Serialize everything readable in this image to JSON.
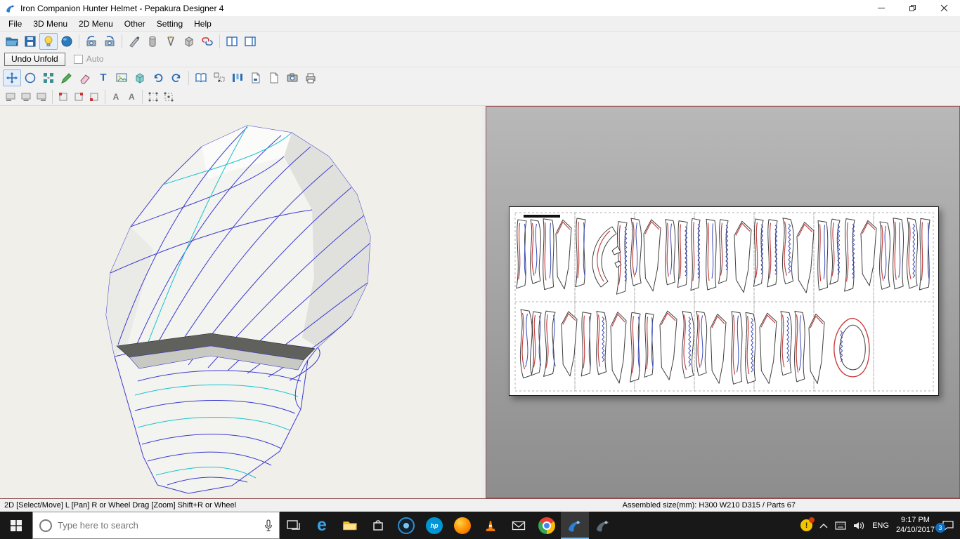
{
  "window": {
    "title": "Iron Companion Hunter Helmet - Pepakura Designer 4"
  },
  "menu": {
    "items": [
      {
        "label": "File"
      },
      {
        "label": "3D Menu"
      },
      {
        "label": "2D Menu"
      },
      {
        "label": "Other"
      },
      {
        "label": "Setting"
      },
      {
        "label": "Help"
      }
    ]
  },
  "toolbar_main": {
    "icon_names": [
      "open-file",
      "save",
      "toggle-light",
      "textured-view",
      "rotate-view-left",
      "rotate-view-right",
      "marker-pen",
      "cylinder-tool",
      "measure-tool",
      "solid-view",
      "link-2d-3d",
      "two-pane-layout",
      "wide-pane-layout"
    ],
    "pressed": "toggle-light"
  },
  "unfold_bar": {
    "undo_button_label": "Undo Unfold",
    "auto_label": "Auto",
    "auto_checked": false
  },
  "toolbar_2d": {
    "text_tool_glyph": "T",
    "icon_names": [
      "select-move",
      "circle-select",
      "divide-merge",
      "edit-flaps",
      "eraser",
      "text-tool",
      "insert-image",
      "3d-box",
      "undo",
      "redo",
      "open-book",
      "select-parts",
      "arrange-parts",
      "page-with-note",
      "blank-page",
      "screen-capture",
      "print"
    ],
    "pressed": "select-move"
  },
  "toolbar_align": {
    "flip_glyph": "A",
    "icon_names": [
      "align-bottom-left",
      "align-bottom-center",
      "align-bottom-right",
      "snap-corner-tl",
      "snap-corner-tr",
      "snap-corner-bl",
      "flip-horizontal",
      "flip-vertical",
      "free-transform",
      "transform-points"
    ]
  },
  "status_bar": {
    "left_text": "2D [Select/Move] L [Pan] R or Wheel Drag [Zoom] Shift+R or Wheel",
    "right_text": "Assembled size(mm): H300 W210 D315 / Parts 67"
  },
  "taskbar": {
    "search_placeholder": "Type here to search",
    "edge_glyph": "e",
    "hp_glyph": "hp",
    "language": "ENG",
    "time": "9:17 PM",
    "date": "24/10/2017",
    "action_center_badge": "3",
    "icon_names": [
      "start",
      "cortana-search",
      "microphone",
      "task-view",
      "edge",
      "file-explorer",
      "store",
      "lens-app",
      "hp-support",
      "firefox",
      "vlc",
      "mail",
      "chrome",
      "pepakura-designer",
      "pepakura-viewer",
      "warning-tray",
      "tray-chevron",
      "touch-keyboard",
      "volume",
      "action-center"
    ]
  }
}
